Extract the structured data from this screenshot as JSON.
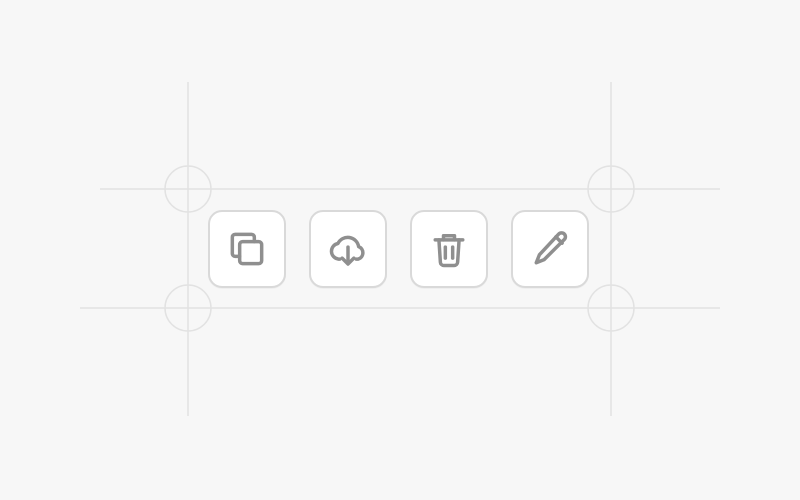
{
  "theme": {
    "background": "#f7f7f7",
    "button_background": "#ffffff",
    "button_border": "#d9d9d9",
    "icon_color": "#8f8f8f",
    "guide_color": "#e2e2e2"
  },
  "toolbar": {
    "buttons": [
      {
        "name": "copy-button",
        "icon": "copy-icon"
      },
      {
        "name": "download-button",
        "icon": "cloud-download-icon"
      },
      {
        "name": "delete-button",
        "icon": "trash-icon"
      },
      {
        "name": "edit-button",
        "icon": "pencil-icon"
      }
    ]
  }
}
